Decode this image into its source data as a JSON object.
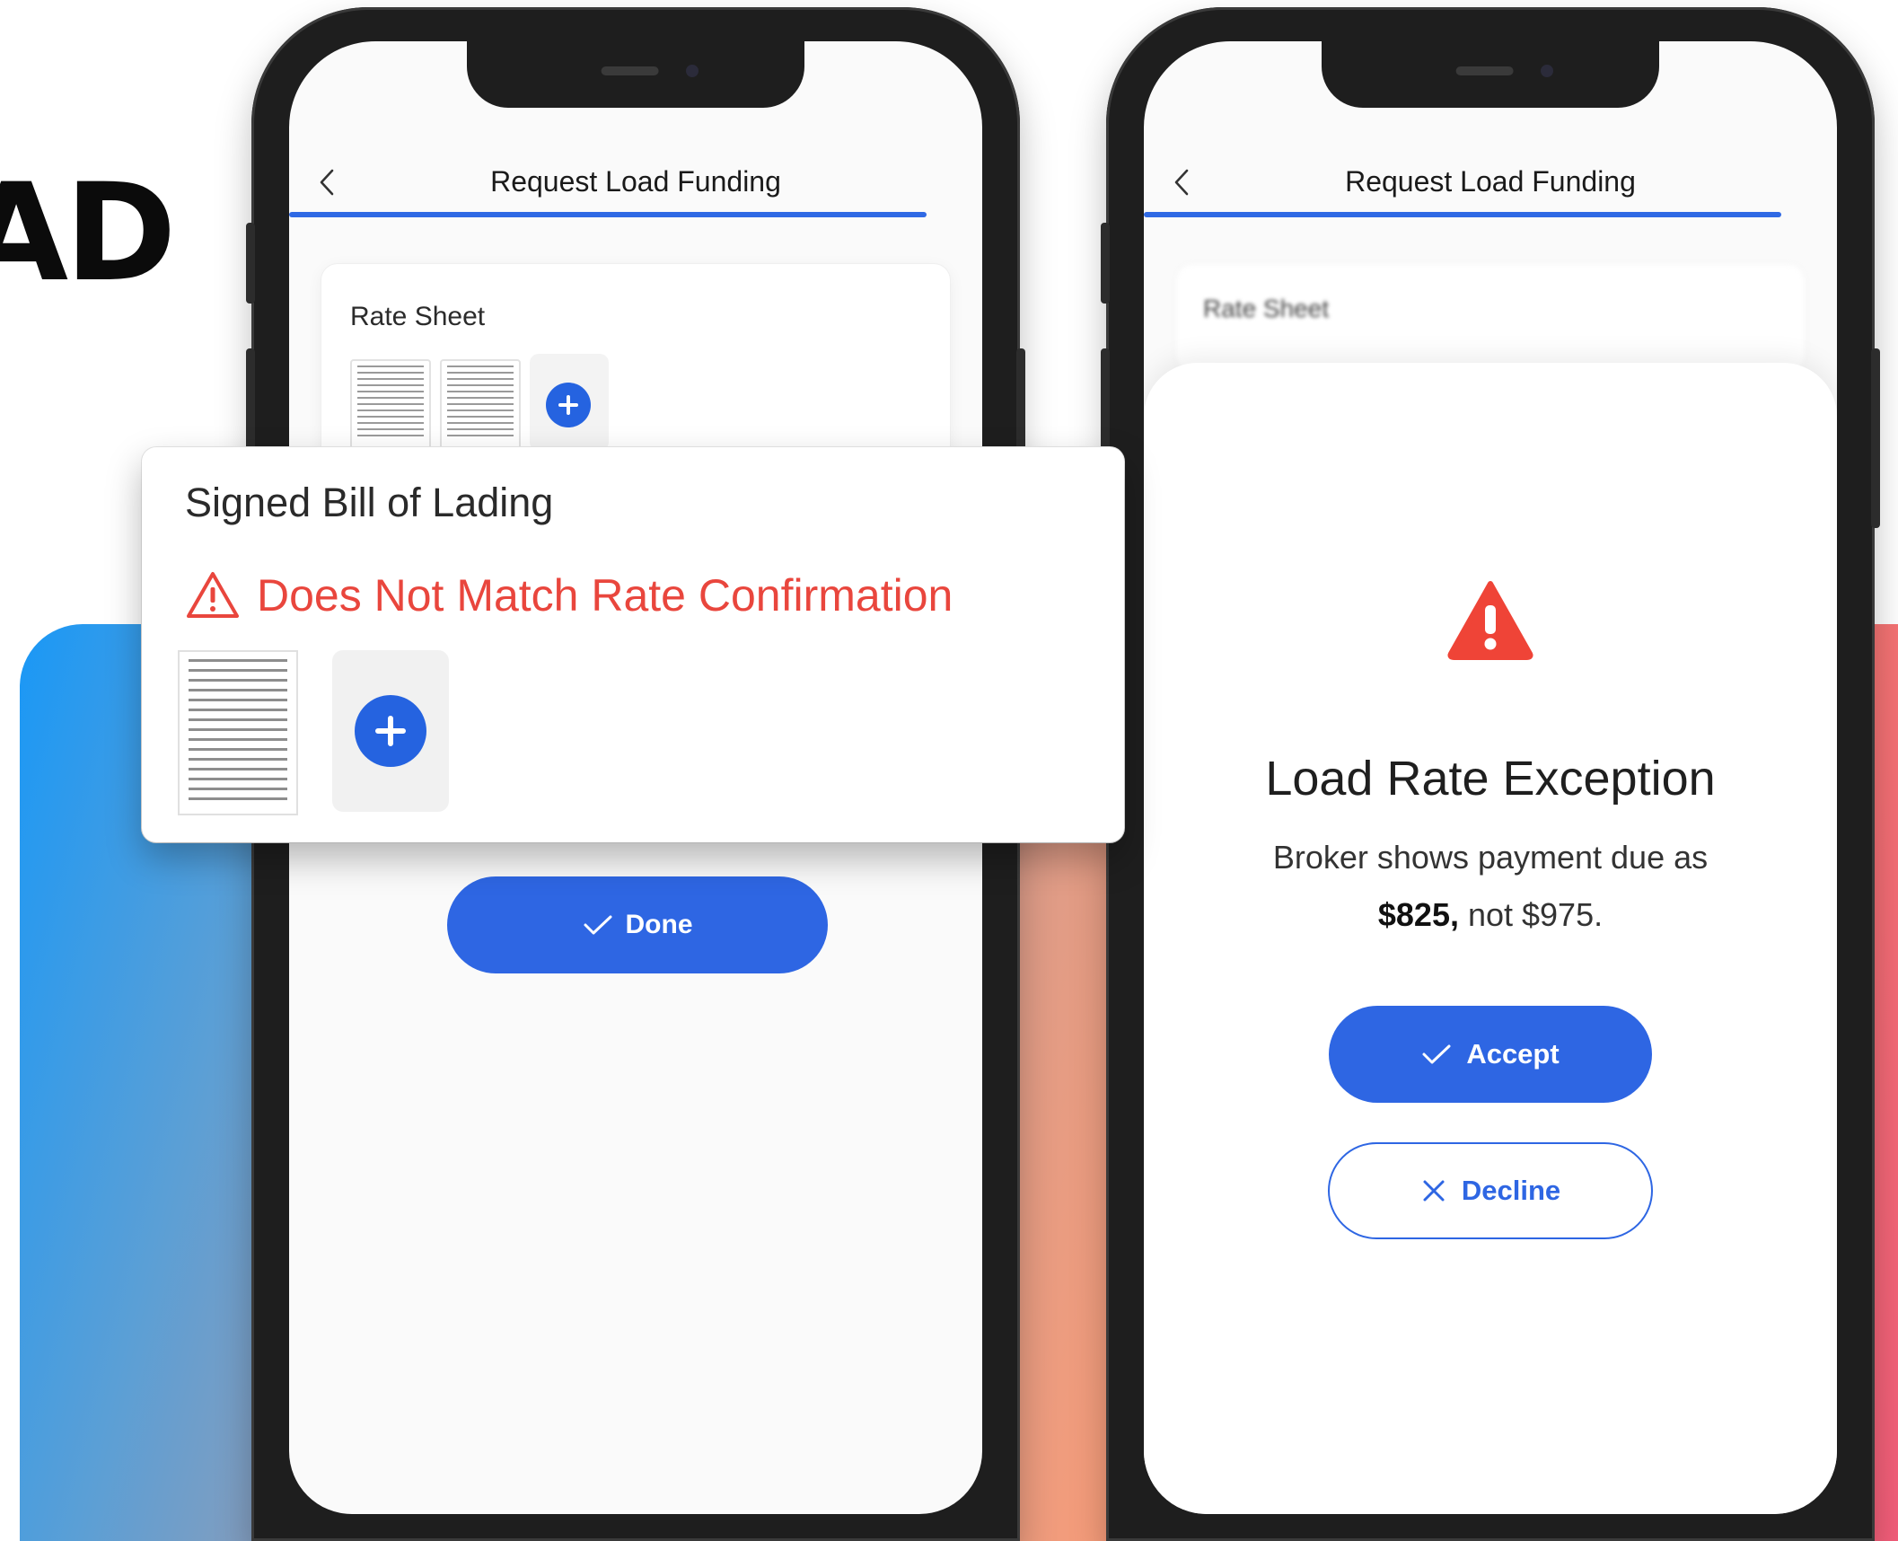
{
  "background": {
    "headline": "AD",
    "gradient_colors": [
      "#1a98f6",
      "#9c9cb0",
      "#f59c7a",
      "#f35d7a"
    ]
  },
  "left_phone": {
    "header_title": "Request Load Funding",
    "progress": 0.92,
    "card_title": "Rate Sheet",
    "done_label": "Done",
    "accent": "#2e66e3"
  },
  "popup": {
    "title": "Signed Bill of Lading",
    "warning": "Does Not Match Rate Confirmation",
    "warning_color": "#e9463d"
  },
  "right_phone": {
    "header_title": "Request Load Funding",
    "progress": 0.92,
    "card_title": "Rate Sheet",
    "dialog_title": "Load Rate Exception",
    "message_line1": "Broker shows payment due as",
    "message_amount": "$825,",
    "message_rest": " not $975.",
    "accept_label": "Accept",
    "decline_label": "Decline"
  }
}
